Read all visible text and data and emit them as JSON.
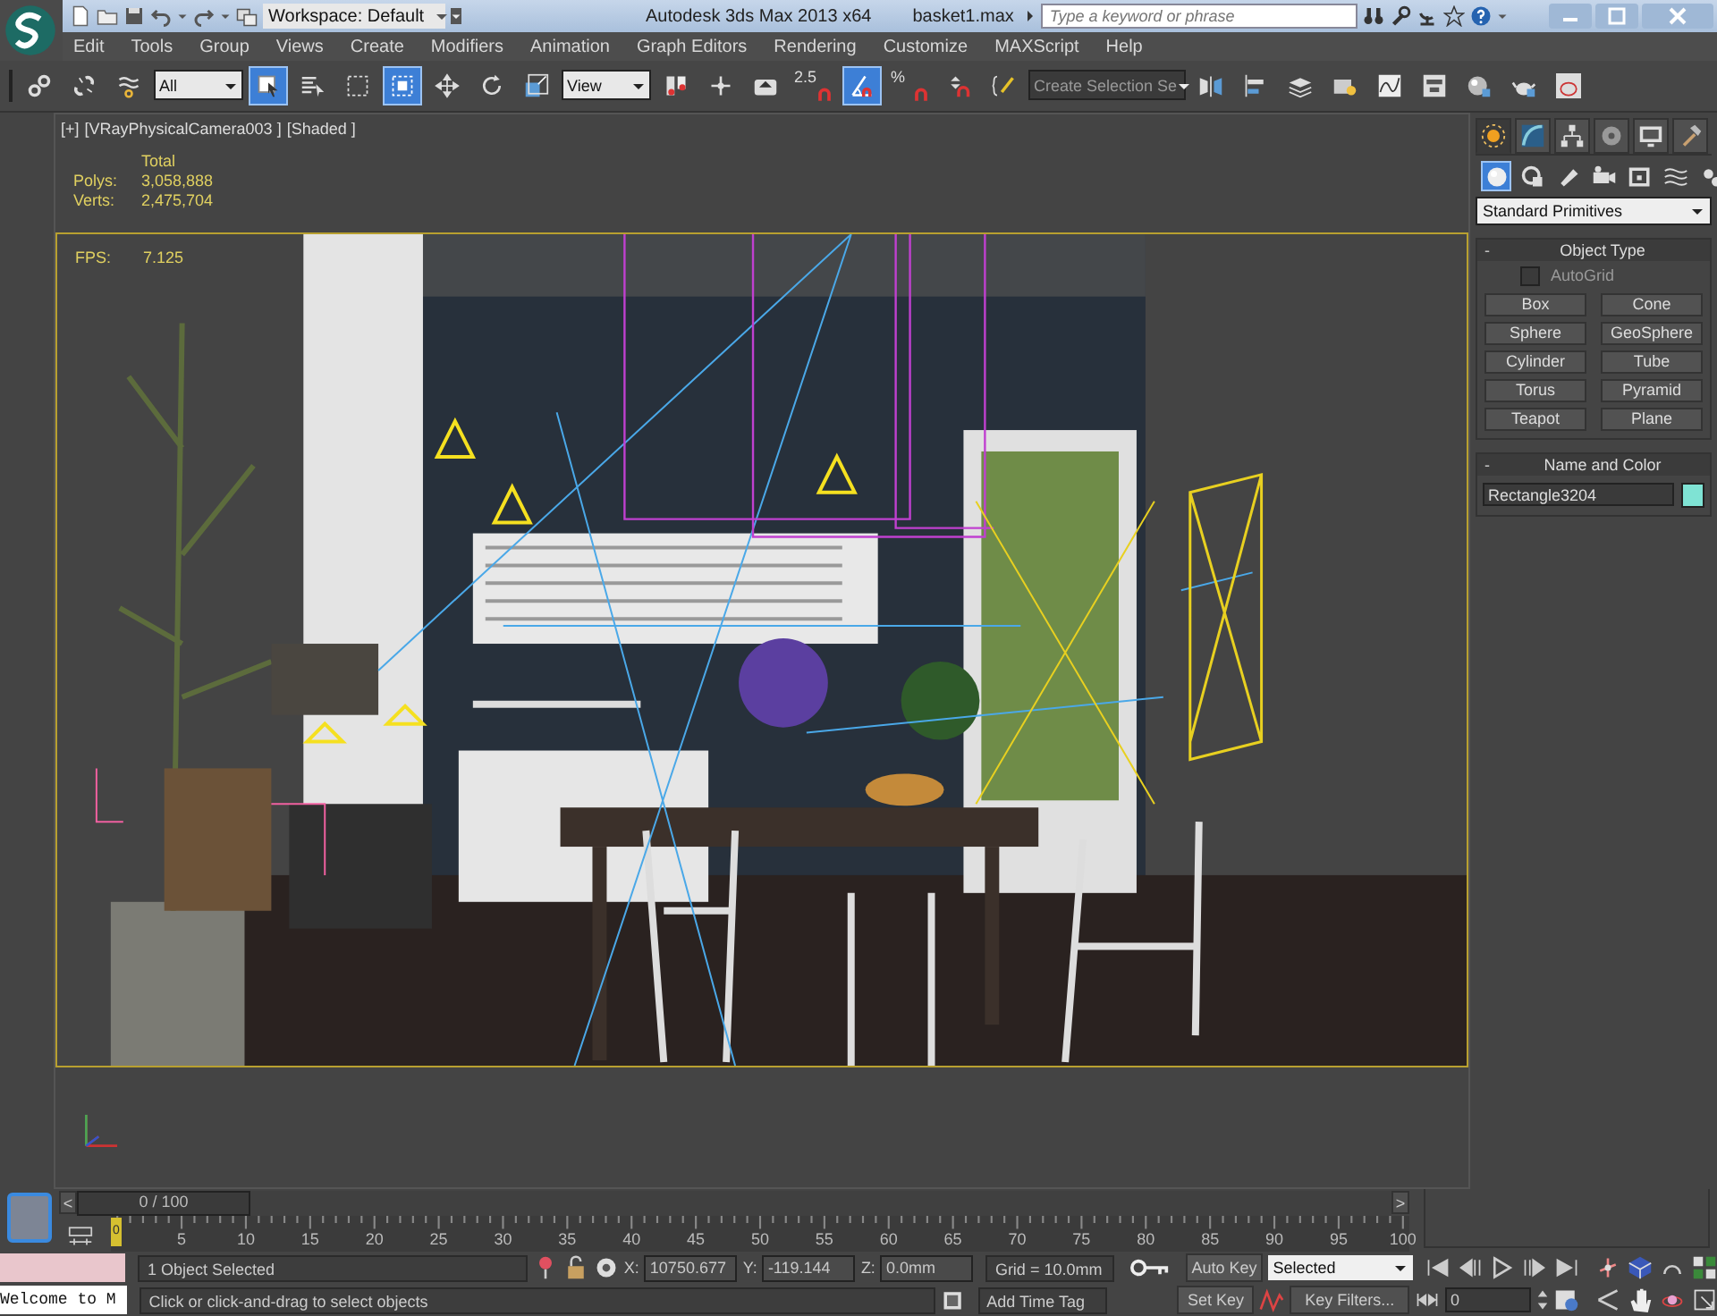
{
  "title_bar": {
    "workspace": "Workspace: Default",
    "title": "Autodesk 3ds Max  2013 x64",
    "file": "basket1.max",
    "search": {
      "placeholder": "Type a keyword or phrase"
    }
  },
  "menu": [
    "Edit",
    "Tools",
    "Group",
    "Views",
    "Create",
    "Modifiers",
    "Animation",
    "Graph Editors",
    "Rendering",
    "Customize",
    "MAXScript",
    "Help"
  ],
  "toolbar": [
    {
      "kind": "button",
      "pressed": false
    },
    {
      "kind": "button",
      "pressed": false
    },
    {
      "kind": "button",
      "pressed": false
    },
    {
      "kind": "dropdown",
      "value": "All"
    },
    {
      "kind": "button",
      "pressed": true
    },
    {
      "kind": "button",
      "pressed": false
    },
    {
      "kind": "button",
      "pressed": false
    },
    {
      "kind": "button",
      "pressed": true
    },
    {
      "kind": "button",
      "pressed": false
    },
    {
      "kind": "button",
      "pressed": false
    },
    {
      "kind": "button",
      "pressed": false
    },
    {
      "kind": "dropdown",
      "value": "View"
    },
    {
      "kind": "button",
      "pressed": false
    },
    {
      "kind": "button",
      "pressed": false
    },
    {
      "kind": "button",
      "pressed": false
    },
    {
      "kind": "snap",
      "label": "2.5",
      "pressed": false
    },
    {
      "kind": "button",
      "pressed": true
    },
    {
      "kind": "snap",
      "label": "%",
      "pressed": false
    },
    {
      "kind": "button",
      "pressed": false
    },
    {
      "kind": "button",
      "pressed": false
    },
    {
      "kind": "dropdown",
      "value": "Create Selection Se"
    },
    {
      "kind": "button",
      "pressed": false
    },
    {
      "kind": "button",
      "pressed": false
    },
    {
      "kind": "button",
      "pressed": false
    },
    {
      "kind": "button",
      "pressed": false
    },
    {
      "kind": "button",
      "pressed": false
    },
    {
      "kind": "button",
      "pressed": false
    },
    {
      "kind": "button",
      "pressed": false
    },
    {
      "kind": "button",
      "pressed": false
    },
    {
      "kind": "button",
      "pressed": false
    }
  ],
  "viewport": {
    "labels": [
      "[+]",
      "[VRayPhysicalCamera003 ]",
      "[Shaded ]"
    ],
    "stats": {
      "header": "Total",
      "rows": [
        {
          "label": "Polys:",
          "value": "3,058,888"
        },
        {
          "label": "Verts:",
          "value": "2,475,704"
        }
      ]
    },
    "fps": {
      "label": "FPS:",
      "value": "7.125"
    }
  },
  "command_panel": {
    "tabs": [
      {
        "selected": true
      },
      {
        "selected": false
      },
      {
        "selected": false
      },
      {
        "selected": false
      },
      {
        "selected": false
      },
      {
        "selected": false
      }
    ],
    "categories": [
      {
        "selected": true
      },
      {
        "selected": false
      },
      {
        "selected": false
      },
      {
        "selected": false
      },
      {
        "selected": false
      },
      {
        "selected": false
      },
      {
        "selected": false
      }
    ],
    "dropdown": "Standard Primitives",
    "rollouts": [
      {
        "kind": "object_type",
        "toggle": "-",
        "title": "Object Type",
        "autogrid": {
          "label": "AutoGrid",
          "checked": false
        },
        "buttons": [
          "Box",
          "Cone",
          "Sphere",
          "GeoSphere",
          "Cylinder",
          "Tube",
          "Torus",
          "Pyramid",
          "Teapot",
          "Plane"
        ]
      },
      {
        "kind": "name_color",
        "toggle": "-",
        "title": "Name and Color",
        "name": "Rectangle3204",
        "color": "#7fe3d4"
      }
    ]
  },
  "timeline": {
    "prev": "<",
    "position": "0 / 100",
    "next": ">",
    "marker": "0",
    "ticks": [
      "5",
      "10",
      "15",
      "20",
      "25",
      "30",
      "35",
      "40",
      "45",
      "50",
      "55",
      "60",
      "65",
      "70",
      "75",
      "80",
      "85",
      "90",
      "95",
      "100"
    ]
  },
  "status": {
    "listener": "Welcome to M",
    "selection": "1 Object Selected",
    "hint": "Click or click-and-drag to select objects",
    "coords": [
      {
        "axis": "X:",
        "value": "10750.677"
      },
      {
        "axis": "Y:",
        "value": "-119.144"
      },
      {
        "axis": "Z:",
        "value": "0.0mm"
      }
    ],
    "grid": "Grid = 10.0mm",
    "time_tag": "Add Time Tag",
    "auto_key": "Auto Key",
    "set_key": "Set Key",
    "key_mode": "Selected",
    "key_filters": "Key Filters...",
    "frame": "0"
  }
}
